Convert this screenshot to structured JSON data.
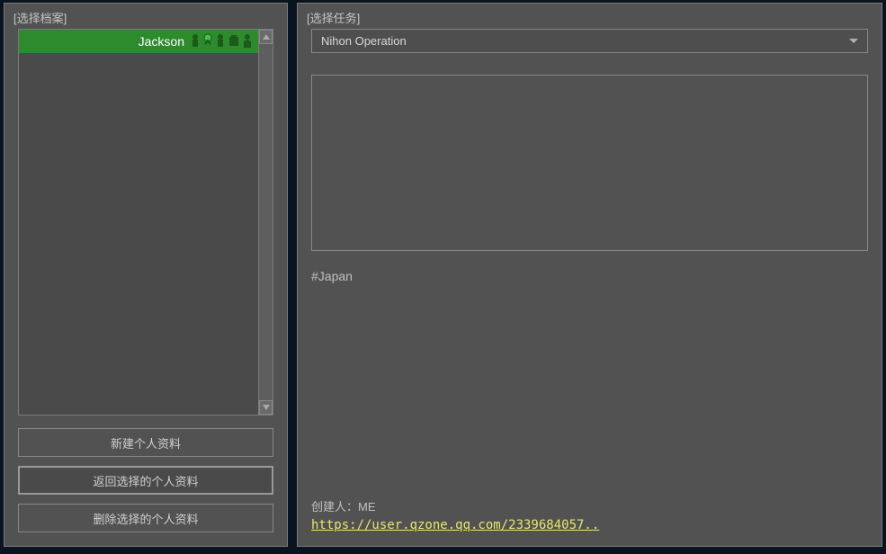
{
  "left": {
    "title": "[选择档案]",
    "profiles": [
      {
        "name": "Jackson"
      }
    ],
    "buttons": {
      "new": "新建个人资料",
      "back": "返回选择的个人资料",
      "delete": "删除选择的个人资料"
    }
  },
  "right": {
    "title": "[选择任务]",
    "mission_selected": "Nihon Operation",
    "hashtag": "#Japan",
    "creator_label": "创建人：",
    "creator_name": "ME",
    "url": "https://user.qzone.qq.com/2339684057.."
  }
}
